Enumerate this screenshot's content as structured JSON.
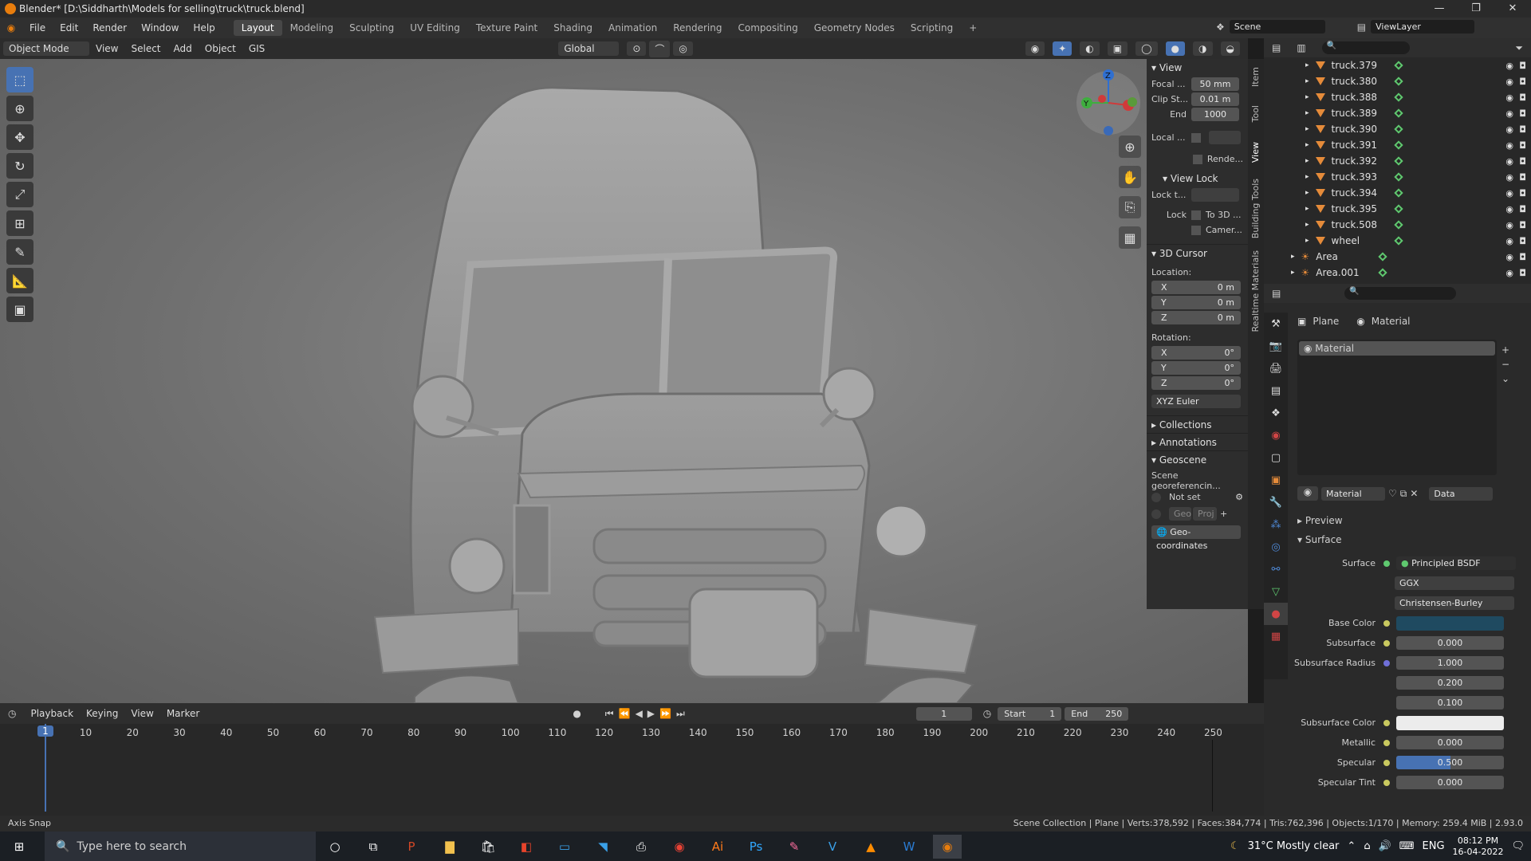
{
  "window": {
    "title": "Blender* [D:\\Siddharth\\Models for selling\\truck\\truck.blend]",
    "controls": [
      "—",
      "❐",
      "✕"
    ]
  },
  "menu": [
    "File",
    "Edit",
    "Render",
    "Window",
    "Help"
  ],
  "workspaces": [
    "Layout",
    "Modeling",
    "Sculpting",
    "UV Editing",
    "Texture Paint",
    "Shading",
    "Animation",
    "Rendering",
    "Compositing",
    "Geometry Nodes",
    "Scripting",
    "+"
  ],
  "scene": {
    "label": "Scene",
    "viewlayer": "ViewLayer"
  },
  "viewport_header": {
    "mode": "Object Mode",
    "items": [
      "View",
      "Select",
      "Add",
      "Object",
      "GIS"
    ],
    "orientation": "Global"
  },
  "npanel": {
    "tabs": [
      "Item",
      "Tool",
      "View",
      "Building Tools",
      "Realtime Materials"
    ],
    "view": {
      "title": "View",
      "focal_label": "Focal ...",
      "focal": "50 mm",
      "clip_label": "Clip St...",
      "clip": "0.01 m",
      "end_label": "End",
      "end": "1000",
      "local_label": "Local ...",
      "render_label": "Rende...",
      "viewlock": "View Lock",
      "lockto_label": "Lock t...",
      "lock_label": "Lock",
      "to3d": "To 3D ...",
      "camera": "Camer..."
    },
    "cursor": {
      "title": "3D Cursor",
      "location": "Location:",
      "x": "0 m",
      "y": "0 m",
      "z": "0 m",
      "rotation": "Rotation:",
      "rx": "0°",
      "ry": "0°",
      "rz": "0°",
      "mode": "XYZ Euler"
    },
    "collections": "Collections",
    "annotations": "Annotations",
    "geoscene": {
      "title": "Geoscene",
      "label": "Scene georeferencin...",
      "notset": "Not set",
      "geo": "Geo",
      "proj": "Proj",
      "coords": "Geo-coordinates"
    }
  },
  "outliner": {
    "items": [
      "truck.379",
      "truck.380",
      "truck.388",
      "truck.389",
      "truck.390",
      "truck.391",
      "truck.392",
      "truck.393",
      "truck.394",
      "truck.395",
      "truck.508",
      "wheel"
    ],
    "lights": [
      "Area",
      "Area.001"
    ]
  },
  "properties": {
    "breadcrumb_obj": "Plane",
    "breadcrumb_mat": "Material",
    "slot": "Material",
    "mat_name": "Material",
    "link": "Data",
    "preview": "Preview",
    "surface_title": "Surface",
    "rows": [
      {
        "label": "Surface",
        "value": "Principled BSDF"
      },
      {
        "label": "",
        "value": "GGX"
      },
      {
        "label": "",
        "value": "Christensen-Burley"
      },
      {
        "label": "Base Color",
        "value": ""
      },
      {
        "label": "Subsurface",
        "value": "0.000"
      },
      {
        "label": "Subsurface Radius",
        "value": "1.000"
      },
      {
        "label": "",
        "value": "0.200"
      },
      {
        "label": "",
        "value": "0.100"
      },
      {
        "label": "Subsurface Color",
        "value": ""
      },
      {
        "label": "Metallic",
        "value": "0.000"
      },
      {
        "label": "Specular",
        "value": "0.500"
      },
      {
        "label": "Specular Tint",
        "value": "0.000"
      }
    ],
    "specular_fraction": 0.5
  },
  "timeline": {
    "menus": [
      "Playback",
      "Keying",
      "View",
      "Marker"
    ],
    "current": "1",
    "start_label": "Start",
    "start": "1",
    "end_label": "End",
    "end": "250",
    "ticks": [
      "1",
      "10",
      "20",
      "30",
      "40",
      "50",
      "60",
      "70",
      "80",
      "90",
      "100",
      "110",
      "120",
      "130",
      "140",
      "150",
      "160",
      "170",
      "180",
      "190",
      "200",
      "210",
      "220",
      "230",
      "240",
      "250"
    ]
  },
  "status": {
    "left": "Axis Snap",
    "right": "Scene Collection | Plane | Verts:378,592 | Faces:384,774 | Tris:762,396 | Objects:1/170 | Memory: 259.4 MiB | 2.93.0"
  },
  "taskbar": {
    "search": "Type here to search",
    "weather": "31°C  Mostly clear",
    "lang": "ENG",
    "time": "08:12 PM",
    "date": "16-04-2022"
  },
  "colors": {
    "accent": "#4772b3",
    "base_color": "#1f4a60",
    "orange": "#e58b3a"
  }
}
